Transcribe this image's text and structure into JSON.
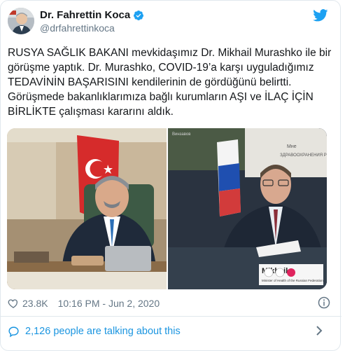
{
  "tweet": {
    "author": {
      "name": "Dr. Fahrettin Koca",
      "handle": "@drfahrettinkoca",
      "verified": true
    },
    "text": "RUSYA SAĞLIK BAKANI mevkidaşımız Dr. Mikhail Murashko ile bir görüşme yaptık. Dr. Murashko, COVID-19’a karşı uyguladığımız TEDAVİNİN BAŞARISINI kendilerinin de gördüğünü belirtti. Görüşmede bakanlıklarımıza bağlı kurumların AŞI ve İLAÇ İÇİN BİRLİKTE çalışması kararını aldık.",
    "media": {
      "left_photo": "photo-of-minister-at-desk",
      "right_photo": "video-call-screenshot",
      "right_caption_name": "Mikhail",
      "right_caption_sub": "Minister of Health of the Russian Federation",
      "right_top_text": "ЗДРАВООХРАНЕНИЯ РОССИЙСКОЙ",
      "right_top_small": "Винзавов",
      "right_top_left": "Мне"
    },
    "likes": "23.8K",
    "timestamp": "10:16 PM - Jun 2, 2020",
    "talking": "2,126 people are talking about this"
  },
  "colors": {
    "twitter_blue": "#1da1f2",
    "link_blue": "#1b95e0",
    "muted": "#657786",
    "text": "#14171a",
    "border": "#e1e8ed"
  },
  "icons": {
    "verified": "verified-badge-icon",
    "bird": "twitter-bird-icon",
    "heart": "heart-icon",
    "info": "info-icon",
    "bubble": "speech-bubble-icon",
    "chevron": "chevron-right-icon"
  }
}
